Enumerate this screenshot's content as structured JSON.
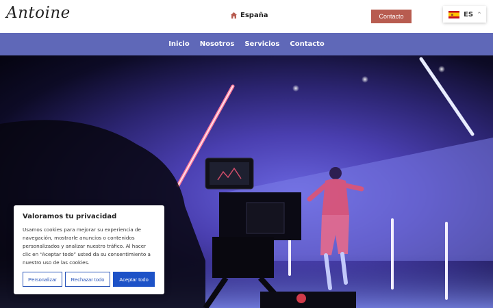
{
  "header": {
    "logo": "Antoine",
    "location": "España",
    "contact_button": "Contacto",
    "language_code": "ES"
  },
  "nav": {
    "items": [
      {
        "label": "Inicio"
      },
      {
        "label": "Nosotros"
      },
      {
        "label": "Servicios"
      },
      {
        "label": "Contacto"
      }
    ]
  },
  "cookie_banner": {
    "title": "Valoramos tu privacidad",
    "text": "Usamos cookies para mejorar su experiencia de navegación, mostrarle anuncios o contenidos personalizados y analizar nuestro tráfico. Al hacer clic en “Aceptar todo” usted da su consentimiento a nuestro uso de las cookies.",
    "customize_button": "Personalizar",
    "reject_button": "Rechazar todo",
    "accept_button": "Aceptar todo"
  },
  "colors": {
    "nav_background": "#5f68b8",
    "contact_button": "#b85c50",
    "accept_button": "#1d52c7",
    "outline_button": "#2a55b9"
  },
  "icons": [
    "home-icon",
    "spain-flag-icon",
    "chevron-up-icon"
  ]
}
